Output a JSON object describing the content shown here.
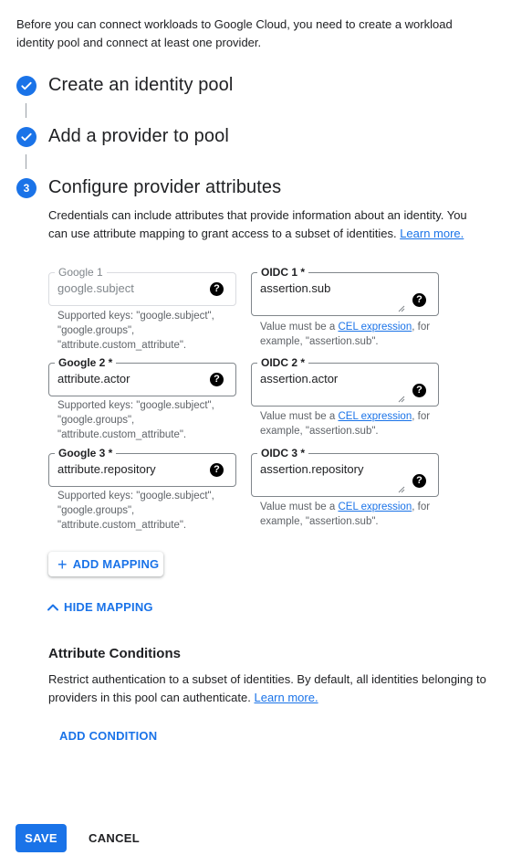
{
  "intro": "Before you can connect workloads to Google Cloud, you need to create a workload identity pool and connect at least one provider.",
  "steps": [
    {
      "number": "1",
      "title": "Create an identity pool",
      "status": "complete"
    },
    {
      "number": "2",
      "title": "Add a provider to pool",
      "status": "complete"
    },
    {
      "number": "3",
      "title": "Configure provider attributes",
      "status": "active"
    }
  ],
  "step3": {
    "description": "Credentials can include attributes that provide information about an identity. You can use attribute mapping to grant access to a subset of identities.",
    "learn_more": "Learn more."
  },
  "mappings": [
    {
      "google_label": "Google 1",
      "google_value": "google.subject",
      "google_disabled": true,
      "google_hint": "Supported keys: \"google.subject\", \"google.groups\", \"attribute.custom_attribute\".",
      "oidc_label": "OIDC 1 *",
      "oidc_value": "assertion.sub",
      "oidc_hint_prefix": "Value must be a",
      "oidc_hint_link": "CEL expression",
      "oidc_hint_suffix": ", for example, \"assertion.sub\"."
    },
    {
      "google_label": "Google 2 *",
      "google_value": "attribute.actor",
      "google_disabled": false,
      "google_hint": "Supported keys: \"google.subject\", \"google.groups\", \"attribute.custom_attribute\".",
      "oidc_label": "OIDC 2 *",
      "oidc_value": "assertion.actor",
      "oidc_hint_prefix": "Value must be a",
      "oidc_hint_link": "CEL expression",
      "oidc_hint_suffix": ", for example, \"assertion.sub\"."
    },
    {
      "google_label": "Google 3 *",
      "google_value": "attribute.repository",
      "google_disabled": false,
      "google_hint": "Supported keys: \"google.subject\", \"google.groups\", \"attribute.custom_attribute\".",
      "oidc_label": "OIDC 3 *",
      "oidc_value": "assertion.repository",
      "oidc_hint_prefix": "Value must be a",
      "oidc_hint_link": "CEL expression",
      "oidc_hint_suffix": ", for example, \"assertion.sub\"."
    }
  ],
  "help_glyph": "?",
  "add_mapping": "ADD MAPPING",
  "hide_mapping": "HIDE MAPPING",
  "conditions": {
    "title": "Attribute Conditions",
    "description": "Restrict authentication to a subset of identities. By default, all identities belonging to providers in this pool can authenticate.",
    "learn_more": "Learn more.",
    "add_condition": "ADD CONDITION"
  },
  "footer": {
    "save": "SAVE",
    "cancel": "CANCEL"
  },
  "colors": {
    "accent": "#1a73e8",
    "text": "#202124",
    "secondary_text": "#5f6368"
  },
  "icons": {
    "complete": "check-icon",
    "help": "help-icon",
    "add": "plus-icon",
    "collapse": "chevron-up-icon"
  }
}
